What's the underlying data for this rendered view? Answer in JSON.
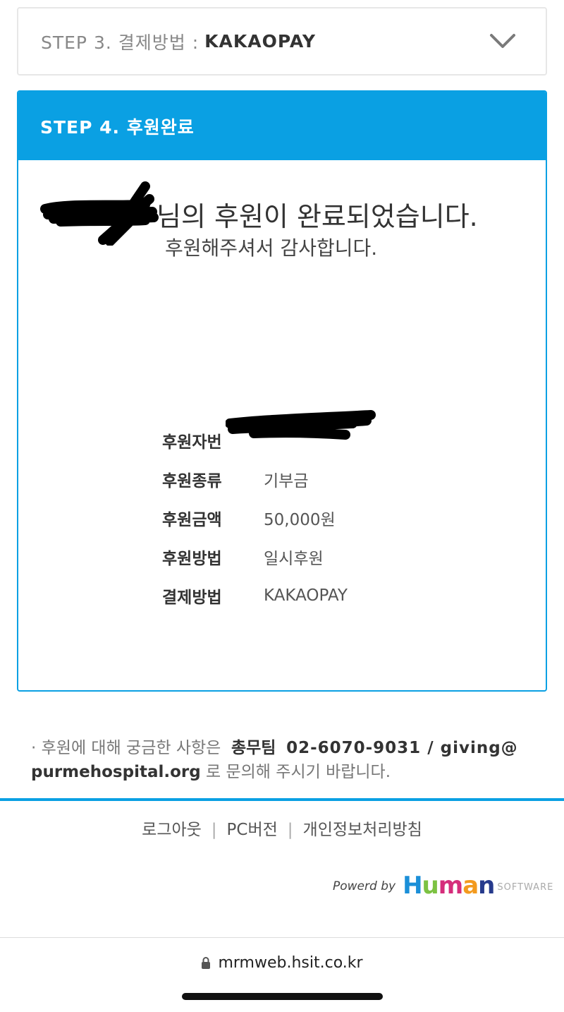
{
  "step3": {
    "label": "STEP 3. 결제방법 :",
    "value": "KAKAOPAY"
  },
  "step4": {
    "title": "STEP 4. 후원완료",
    "message_line1": "님의 후원이 완료되었습니다.",
    "message_line2": "후원해주셔서 감사합니다.",
    "rows": [
      {
        "key": "후원자번",
        "value": ""
      },
      {
        "key": "후원종류",
        "value": "기부금"
      },
      {
        "key": "후원금액",
        "value": "50,000원"
      },
      {
        "key": "후원방법",
        "value": "일시후원"
      },
      {
        "key": "결제방법",
        "value": "KAKAOPAY"
      }
    ]
  },
  "notice": {
    "prefix": "· 후원에 대해 궁금한 사항은",
    "team": "총무팀",
    "contact": "02-6070-9031 / giving@",
    "email_rest": "purmehospital.org",
    "suffix": "로 문의해 주시기 바랍니다."
  },
  "footer": {
    "links": [
      "로그아웃",
      "PC버전",
      "개인정보처리방침"
    ],
    "powered_by": "Powerd by",
    "logo_h": "H",
    "logo_u": "u",
    "logo_m": "m",
    "logo_a": "a",
    "logo_n": "n",
    "logo_software": "SOFTWARE"
  },
  "browser": {
    "url": "mrmweb.hsit.co.kr"
  },
  "colors": {
    "accent": "#0aa0e3",
    "logo_blue": "#1b8fd8",
    "logo_green": "#7cc242",
    "logo_pink": "#d52d7b",
    "logo_orange": "#f39a1e",
    "logo_navy": "#263a8c"
  }
}
